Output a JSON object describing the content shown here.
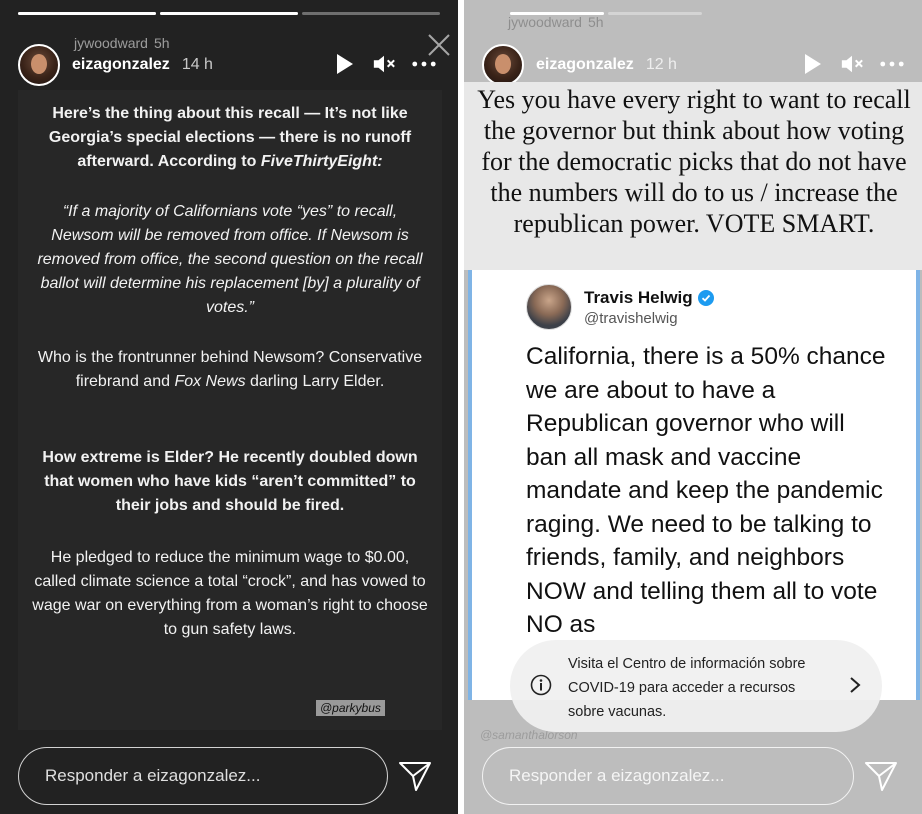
{
  "left": {
    "progress": [
      1,
      1,
      0
    ],
    "prev_user": "jywoodward",
    "prev_time": "5h",
    "username": "eizagonzalez",
    "time": "14 h",
    "paragraphs": [
      {
        "style": "bold",
        "text": "Here’s the thing about this recall — It’s not like Georgia’s special elections — there is no runoff afterward. According to ",
        "tail": "FiveThirtyEight:"
      },
      {
        "style": "italic",
        "text": "“If a majority of Californians vote “yes” to recall, Newsom will be removed from office. If Newsom is removed from office, the second question on the recall ballot will determine his replacement [by] a plurality of votes.”"
      },
      {
        "style": "normal",
        "text": "Who is the frontrunner behind Newsom? Conservative firebrand and ",
        "em": "Fox News",
        "tail": " darling Larry Elder."
      },
      {
        "style": "bold",
        "text": "How extreme is Elder? He recently doubled down that women who have kids “aren’t committed” to their jobs and should be fired."
      },
      {
        "style": "normal",
        "text": "He pledged to reduce the minimum wage to $0.00, called climate science a total “crock”, and has vowed to wage war on everything from a woman’s right to choose to gun safety laws."
      }
    ],
    "watermark": "@parkybus",
    "reply_placeholder": "Responder a eizagonzalez..."
  },
  "right": {
    "progress": [
      1,
      0
    ],
    "prev_user": "jywoodward",
    "prev_time": "5h",
    "username": "eizagonzalez",
    "time": "12 h",
    "note": "Yes you have every right to want to recall the governor but think about how voting for the democratic picks that do not have the numbers will do to us / increase the republican power. VOTE SMART.",
    "tweet": {
      "name": "Travis Helwig",
      "handle": "@travishelwig",
      "body": "California, there is a 50% chance we are about to have a Republican governor who will ban all mask and vaccine mandate and keep the pandemic raging. We need to be talking to friends, family, and neighbors NOW and telling them all to vote NO as"
    },
    "covid_banner": "Visita el Centro de información sobre COVID-19 para acceder a recursos sobre vacunas.",
    "ghost_watermark": "@samanthalorson",
    "reply_placeholder": "Responder a eizagonzalez..."
  }
}
